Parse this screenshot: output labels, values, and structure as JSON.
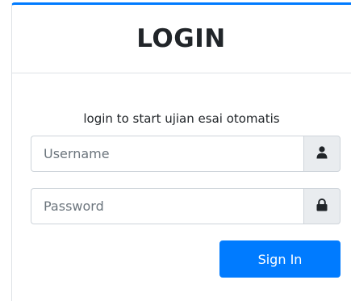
{
  "header": {
    "title": "LOGIN"
  },
  "body": {
    "message": "login to start ujian esai otomatis"
  },
  "form": {
    "username_placeholder": "Username",
    "username_value": "",
    "username_icon": "user-icon",
    "password_placeholder": "Password",
    "password_value": "",
    "password_icon": "lock-icon",
    "signin_label": "Sign In"
  },
  "colors": {
    "accent": "#007bff",
    "addon_bg": "#e9ecef",
    "border": "#ced4da"
  }
}
